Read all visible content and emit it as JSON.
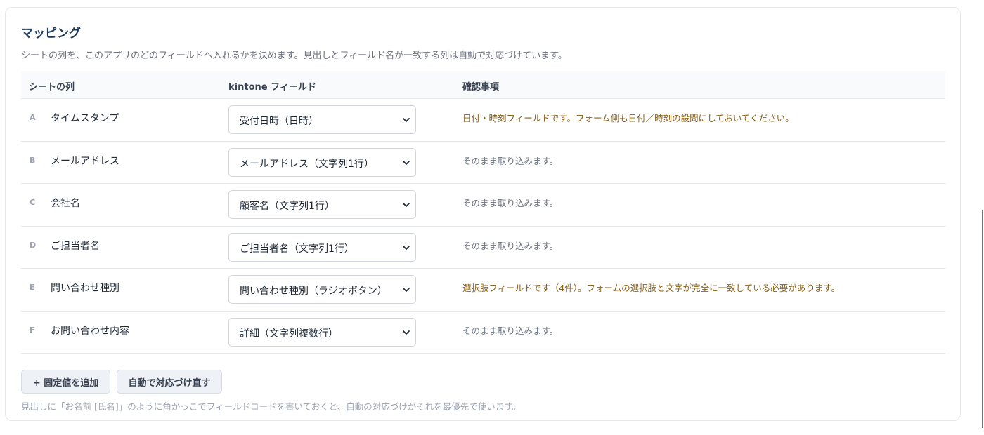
{
  "section": {
    "title": "マッピング",
    "description": "シートの列を、このアプリのどのフィールドへ入れるかを決めます。見出しとフィールド名が一致する列は自動で対応づけています。"
  },
  "table": {
    "headers": {
      "sheet_column": "シートの列",
      "kintone_field": "kintone フィールド",
      "notes": "確認事項"
    },
    "rows": [
      {
        "letter": "A",
        "name": "タイムスタンプ",
        "field": "受付日時（日時）",
        "note": "日付・時刻フィールドです。フォーム側も日付／時刻の設問にしておいてください。",
        "note_type": "warning"
      },
      {
        "letter": "B",
        "name": "メールアドレス",
        "field": "メールアドレス（文字列1行）",
        "note": "そのまま取り込みます。",
        "note_type": "info"
      },
      {
        "letter": "C",
        "name": "会社名",
        "field": "顧客名（文字列1行）",
        "note": "そのまま取り込みます。",
        "note_type": "info"
      },
      {
        "letter": "D",
        "name": "ご担当者名",
        "field": "ご担当者名（文字列1行）",
        "note": "そのまま取り込みます。",
        "note_type": "info"
      },
      {
        "letter": "E",
        "name": "問い合わせ種別",
        "field": "問い合わせ種別（ラジオボタン）",
        "note": "選択肢フィールドです（4件）。フォームの選択肢と文字が完全に一致している必要があります。",
        "note_type": "warning"
      },
      {
        "letter": "F",
        "name": "お問い合わせ内容",
        "field": "詳細（文字列複数行）",
        "note": "そのまま取り込みます。",
        "note_type": "info"
      }
    ]
  },
  "actions": {
    "add_fixed_label": "+ 固定値を追加",
    "auto_map_label": "自動で対応づけ直す"
  },
  "footer_hint": "見出しに「お名前 [氏名]」のように角かっこでフィールドコードを書いておくと、自動の対応づけがそれを最優先で使います。",
  "colors": {
    "title": "#1e3a5f",
    "warning_text": "#8a6116",
    "muted_text": "#6b7280"
  }
}
